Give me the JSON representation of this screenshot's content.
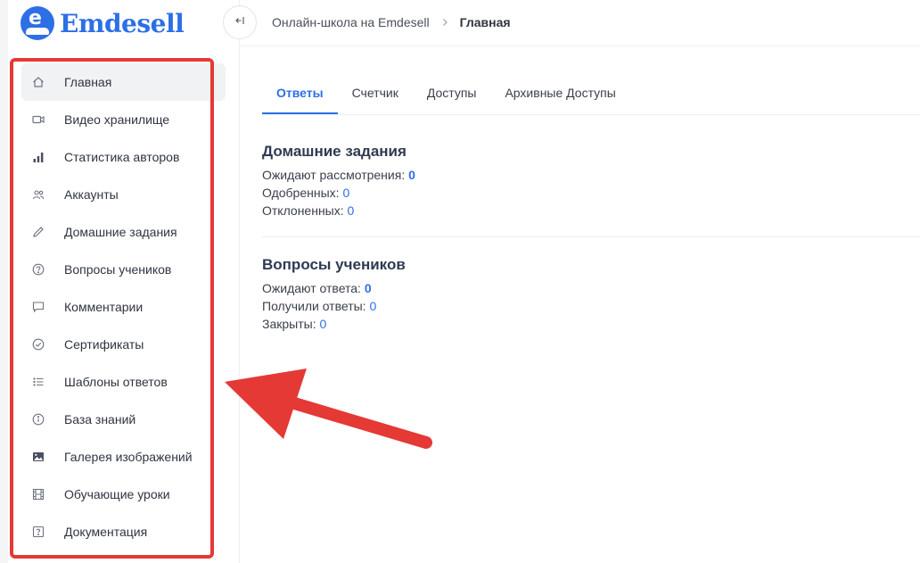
{
  "brand": {
    "name": "Emdesell",
    "mark": "e",
    "color": "#2c6fe6"
  },
  "sidebar": {
    "items": [
      {
        "label": "Главная",
        "icon": "home-icon",
        "active": true
      },
      {
        "label": "Видео хранилище",
        "icon": "video-icon"
      },
      {
        "label": "Статистика авторов",
        "icon": "bar-chart-icon"
      },
      {
        "label": "Аккаунты",
        "icon": "users-icon"
      },
      {
        "label": "Домашние задания",
        "icon": "pencil-icon"
      },
      {
        "label": "Вопросы учеников",
        "icon": "question-circle-icon"
      },
      {
        "label": "Комментарии",
        "icon": "comment-icon"
      },
      {
        "label": "Сертификаты",
        "icon": "certificate-icon"
      },
      {
        "label": "Шаблоны ответов",
        "icon": "list-icon"
      },
      {
        "label": "База знаний",
        "icon": "info-icon"
      },
      {
        "label": "Галерея изображений",
        "icon": "image-icon"
      },
      {
        "label": "Обучающие уроки",
        "icon": "film-icon"
      },
      {
        "label": "Документация",
        "icon": "help-square-icon"
      }
    ]
  },
  "breadcrumb": {
    "parent": "Онлайн-школа на Emdesell",
    "current": "Главная"
  },
  "tabs": [
    {
      "label": "Ответы",
      "active": true
    },
    {
      "label": "Счетчик"
    },
    {
      "label": "Доступы"
    },
    {
      "label": "Архивные Доступы"
    }
  ],
  "homework": {
    "title": "Домашние задания",
    "pending_label": "Ожидают рассмотрения:",
    "pending_value": "0",
    "approved_label": "Одобренных:",
    "approved_value": "0",
    "rejected_label": "Отклоненных:",
    "rejected_value": "0"
  },
  "questions": {
    "title": "Вопросы учеников",
    "waiting_label": "Ожидают ответа:",
    "waiting_value": "0",
    "answered_label": "Получили ответы:",
    "answered_value": "0",
    "closed_label": "Закрыты:",
    "closed_value": "0"
  },
  "annotation": {
    "color": "#e53935"
  }
}
